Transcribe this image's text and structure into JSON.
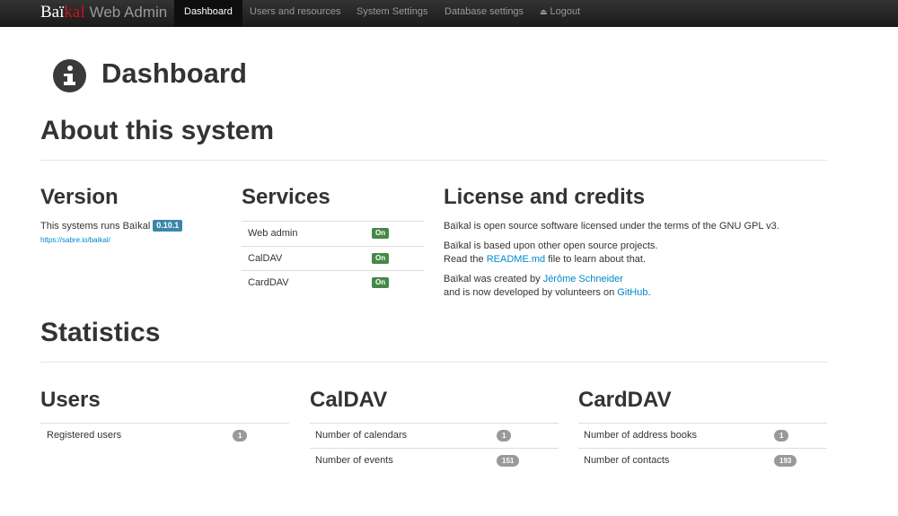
{
  "nav": {
    "brand_part1": "Baï",
    "brand_part2": "kal",
    "brand_part3": "Web Admin",
    "items": [
      {
        "label": "Dashboard",
        "active": true
      },
      {
        "label": "Users and resources"
      },
      {
        "label": "System Settings"
      },
      {
        "label": "Database settings"
      },
      {
        "label": "Logout",
        "icon": "eject-icon"
      }
    ]
  },
  "page": {
    "title": "Dashboard",
    "icon": "info-icon",
    "about_heading": "About this system",
    "statistics_heading": "Statistics"
  },
  "version": {
    "heading": "Version",
    "text": "This systems runs Baïkal",
    "badge": "0.10.1",
    "url": "https://sabre.io/baikal/"
  },
  "services": {
    "heading": "Services",
    "rows": [
      {
        "name": "Web admin",
        "status": "On"
      },
      {
        "name": "CalDAV",
        "status": "On"
      },
      {
        "name": "CardDAV",
        "status": "On"
      }
    ]
  },
  "license": {
    "heading": "License and credits",
    "p1": "Baïkal is open source software licensed under the terms of the GNU GPL v3.",
    "p2_line1": "Baïkal is based upon other open source projects.",
    "p2_read": "Read the",
    "p2_link": "README.md",
    "p2_rest": "file to learn about that.",
    "p3_pre": "Baïkal was created by",
    "p3_author": "Jérôme Schneider",
    "p3_line2": "and is now developed by volunteers on",
    "p3_github": "GitHub",
    "p3_period": "."
  },
  "stats": {
    "users": {
      "heading": "Users",
      "rows": [
        {
          "label": "Registered users",
          "value": "1"
        }
      ]
    },
    "caldav": {
      "heading": "CalDAV",
      "rows": [
        {
          "label": "Number of calendars",
          "value": "1"
        },
        {
          "label": "Number of events",
          "value": "151"
        }
      ]
    },
    "carddav": {
      "heading": "CardDAV",
      "rows": [
        {
          "label": "Number of address books",
          "value": "1"
        },
        {
          "label": "Number of contacts",
          "value": "193"
        }
      ]
    }
  },
  "colors": {
    "navbar": "#222222",
    "brand_accent": "#c5161d",
    "link": "#0088cc",
    "on_label": "#468847",
    "version_label": "#3a87ad",
    "badge": "#999999"
  }
}
